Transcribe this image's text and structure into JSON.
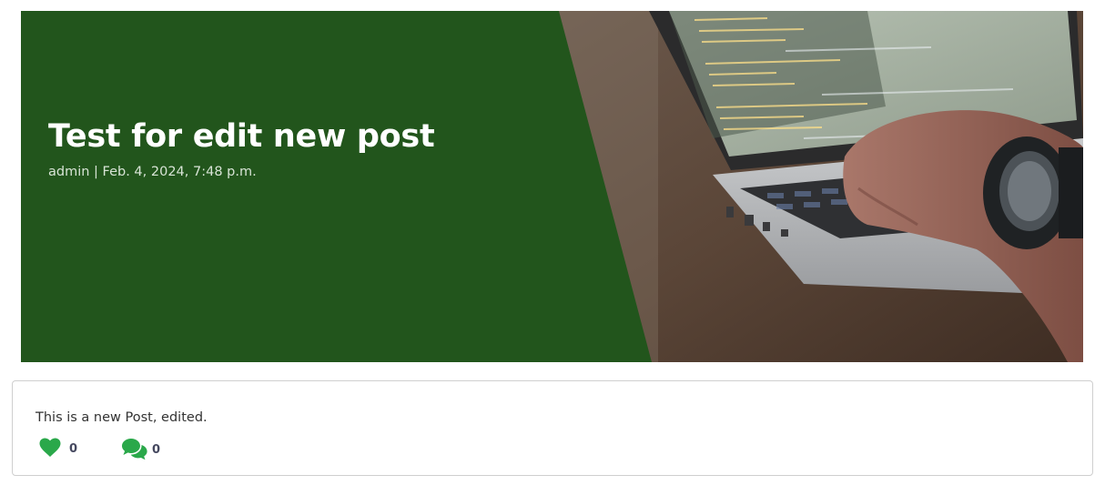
{
  "post": {
    "title": "Test for edit new post",
    "meta": "admin | Feb. 4, 2024, 7:48 p.m.",
    "content": "This is a new Post, edited.",
    "likes": "0",
    "comments": "0"
  },
  "colors": {
    "hero_green": "#22551c",
    "accent_green": "#2aa84a",
    "count_text": "#45485f"
  },
  "icons": {
    "likes": "heart-icon",
    "comments": "comments-icon"
  }
}
